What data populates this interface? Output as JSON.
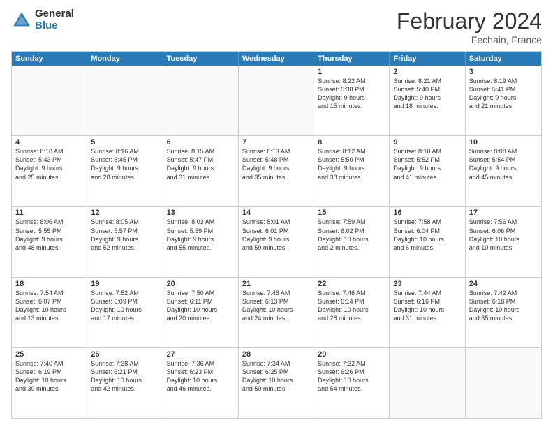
{
  "logo": {
    "general": "General",
    "blue": "Blue"
  },
  "title": "February 2024",
  "subtitle": "Fechain, France",
  "header_days": [
    "Sunday",
    "Monday",
    "Tuesday",
    "Wednesday",
    "Thursday",
    "Friday",
    "Saturday"
  ],
  "rows": [
    [
      {
        "day": "",
        "info": "",
        "empty": true
      },
      {
        "day": "",
        "info": "",
        "empty": true
      },
      {
        "day": "",
        "info": "",
        "empty": true
      },
      {
        "day": "",
        "info": "",
        "empty": true
      },
      {
        "day": "1",
        "info": "Sunrise: 8:22 AM\nSunset: 5:38 PM\nDaylight: 9 hours\nand 15 minutes.",
        "empty": false
      },
      {
        "day": "2",
        "info": "Sunrise: 8:21 AM\nSunset: 5:40 PM\nDaylight: 9 hours\nand 18 minutes.",
        "empty": false
      },
      {
        "day": "3",
        "info": "Sunrise: 8:19 AM\nSunset: 5:41 PM\nDaylight: 9 hours\nand 21 minutes.",
        "empty": false
      }
    ],
    [
      {
        "day": "4",
        "info": "Sunrise: 8:18 AM\nSunset: 5:43 PM\nDaylight: 9 hours\nand 25 minutes.",
        "empty": false
      },
      {
        "day": "5",
        "info": "Sunrise: 8:16 AM\nSunset: 5:45 PM\nDaylight: 9 hours\nand 28 minutes.",
        "empty": false
      },
      {
        "day": "6",
        "info": "Sunrise: 8:15 AM\nSunset: 5:47 PM\nDaylight: 9 hours\nand 31 minutes.",
        "empty": false
      },
      {
        "day": "7",
        "info": "Sunrise: 8:13 AM\nSunset: 5:48 PM\nDaylight: 9 hours\nand 35 minutes.",
        "empty": false
      },
      {
        "day": "8",
        "info": "Sunrise: 8:12 AM\nSunset: 5:50 PM\nDaylight: 9 hours\nand 38 minutes.",
        "empty": false
      },
      {
        "day": "9",
        "info": "Sunrise: 8:10 AM\nSunset: 5:52 PM\nDaylight: 9 hours\nand 41 minutes.",
        "empty": false
      },
      {
        "day": "10",
        "info": "Sunrise: 8:08 AM\nSunset: 5:54 PM\nDaylight: 9 hours\nand 45 minutes.",
        "empty": false
      }
    ],
    [
      {
        "day": "11",
        "info": "Sunrise: 8:06 AM\nSunset: 5:55 PM\nDaylight: 9 hours\nand 48 minutes.",
        "empty": false
      },
      {
        "day": "12",
        "info": "Sunrise: 8:05 AM\nSunset: 5:57 PM\nDaylight: 9 hours\nand 52 minutes.",
        "empty": false
      },
      {
        "day": "13",
        "info": "Sunrise: 8:03 AM\nSunset: 5:59 PM\nDaylight: 9 hours\nand 55 minutes.",
        "empty": false
      },
      {
        "day": "14",
        "info": "Sunrise: 8:01 AM\nSunset: 6:01 PM\nDaylight: 9 hours\nand 59 minutes.",
        "empty": false
      },
      {
        "day": "15",
        "info": "Sunrise: 7:59 AM\nSunset: 6:02 PM\nDaylight: 10 hours\nand 2 minutes.",
        "empty": false
      },
      {
        "day": "16",
        "info": "Sunrise: 7:58 AM\nSunset: 6:04 PM\nDaylight: 10 hours\nand 6 minutes.",
        "empty": false
      },
      {
        "day": "17",
        "info": "Sunrise: 7:56 AM\nSunset: 6:06 PM\nDaylight: 10 hours\nand 10 minutes.",
        "empty": false
      }
    ],
    [
      {
        "day": "18",
        "info": "Sunrise: 7:54 AM\nSunset: 6:07 PM\nDaylight: 10 hours\nand 13 minutes.",
        "empty": false
      },
      {
        "day": "19",
        "info": "Sunrise: 7:52 AM\nSunset: 6:09 PM\nDaylight: 10 hours\nand 17 minutes.",
        "empty": false
      },
      {
        "day": "20",
        "info": "Sunrise: 7:50 AM\nSunset: 6:11 PM\nDaylight: 10 hours\nand 20 minutes.",
        "empty": false
      },
      {
        "day": "21",
        "info": "Sunrise: 7:48 AM\nSunset: 6:13 PM\nDaylight: 10 hours\nand 24 minutes.",
        "empty": false
      },
      {
        "day": "22",
        "info": "Sunrise: 7:46 AM\nSunset: 6:14 PM\nDaylight: 10 hours\nand 28 minutes.",
        "empty": false
      },
      {
        "day": "23",
        "info": "Sunrise: 7:44 AM\nSunset: 6:16 PM\nDaylight: 10 hours\nand 31 minutes.",
        "empty": false
      },
      {
        "day": "24",
        "info": "Sunrise: 7:42 AM\nSunset: 6:18 PM\nDaylight: 10 hours\nand 35 minutes.",
        "empty": false
      }
    ],
    [
      {
        "day": "25",
        "info": "Sunrise: 7:40 AM\nSunset: 6:19 PM\nDaylight: 10 hours\nand 39 minutes.",
        "empty": false
      },
      {
        "day": "26",
        "info": "Sunrise: 7:38 AM\nSunset: 6:21 PM\nDaylight: 10 hours\nand 42 minutes.",
        "empty": false
      },
      {
        "day": "27",
        "info": "Sunrise: 7:36 AM\nSunset: 6:23 PM\nDaylight: 10 hours\nand 46 minutes.",
        "empty": false
      },
      {
        "day": "28",
        "info": "Sunrise: 7:34 AM\nSunset: 6:25 PM\nDaylight: 10 hours\nand 50 minutes.",
        "empty": false
      },
      {
        "day": "29",
        "info": "Sunrise: 7:32 AM\nSunset: 6:26 PM\nDaylight: 10 hours\nand 54 minutes.",
        "empty": false
      },
      {
        "day": "",
        "info": "",
        "empty": true
      },
      {
        "day": "",
        "info": "",
        "empty": true
      }
    ]
  ]
}
